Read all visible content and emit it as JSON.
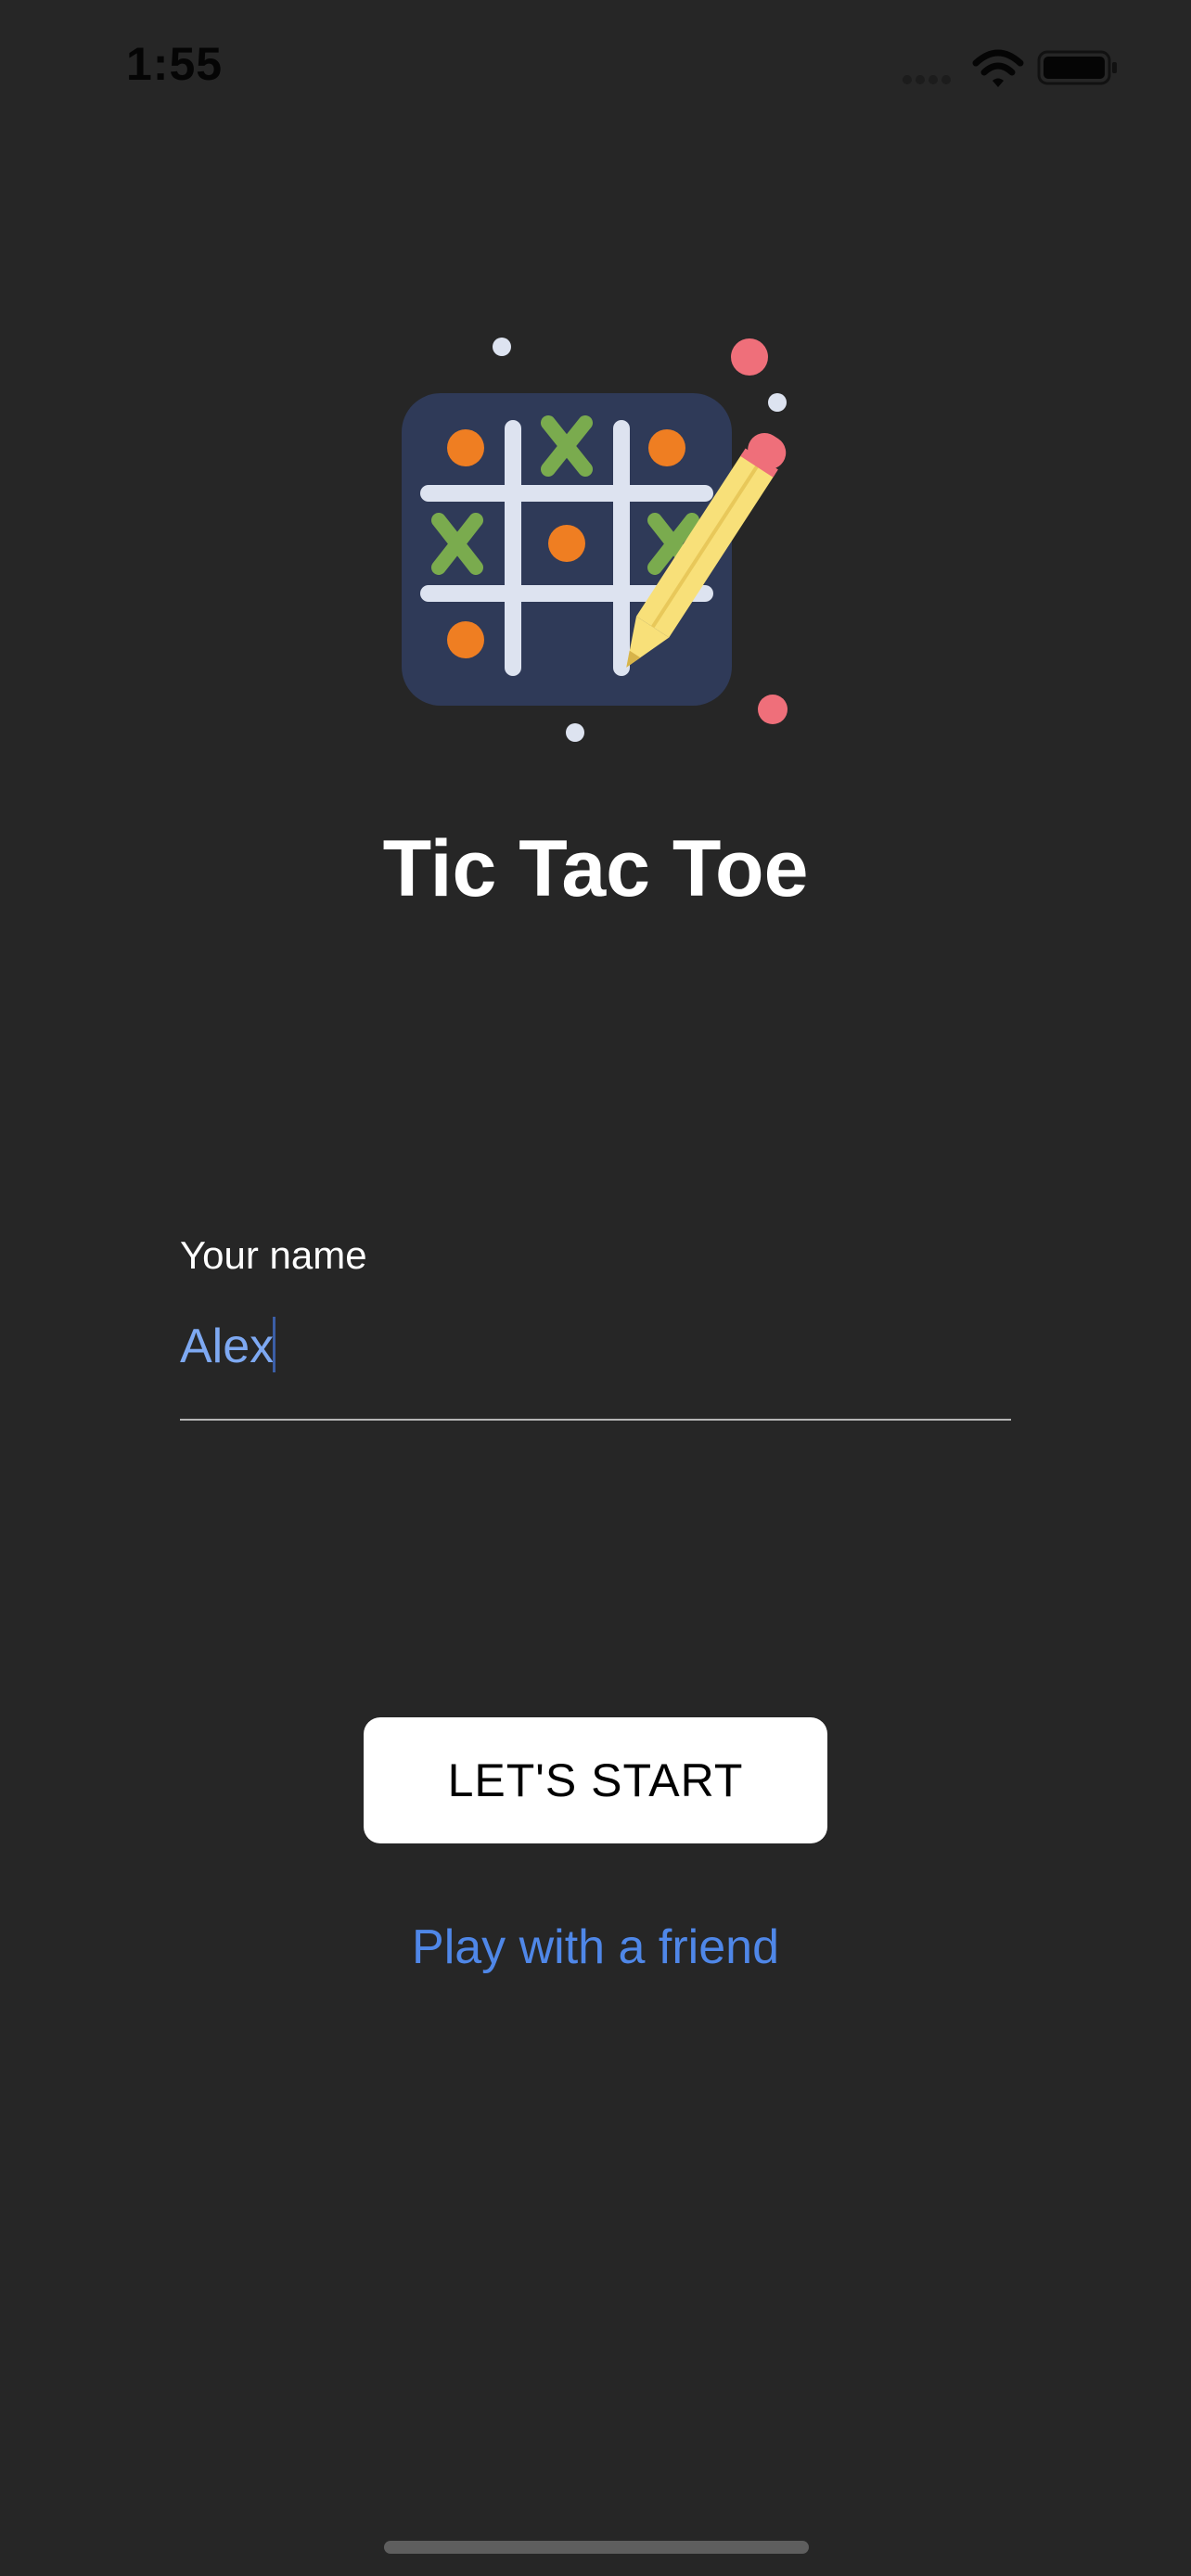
{
  "status_bar": {
    "time": "1:55"
  },
  "app": {
    "title": "Tic Tac Toe",
    "logo_icon": "tic-tac-toe-pencil-icon"
  },
  "name_field": {
    "label": "Your name",
    "value": "Alex",
    "placeholder": ""
  },
  "actions": {
    "start_label": "LET'S START",
    "friend_label": "Play with a friend"
  },
  "colors": {
    "background": "#262626",
    "accent_link": "#4f87e8",
    "input_text": "#7ea9f2",
    "logo_board": "#2f3a58",
    "grid_lines": "#dde3f0",
    "o_marks": "#ef7e22",
    "x_marks": "#7aab4e",
    "pencil": "#f8e079",
    "pencil_eraser": "#ef6f7a"
  }
}
